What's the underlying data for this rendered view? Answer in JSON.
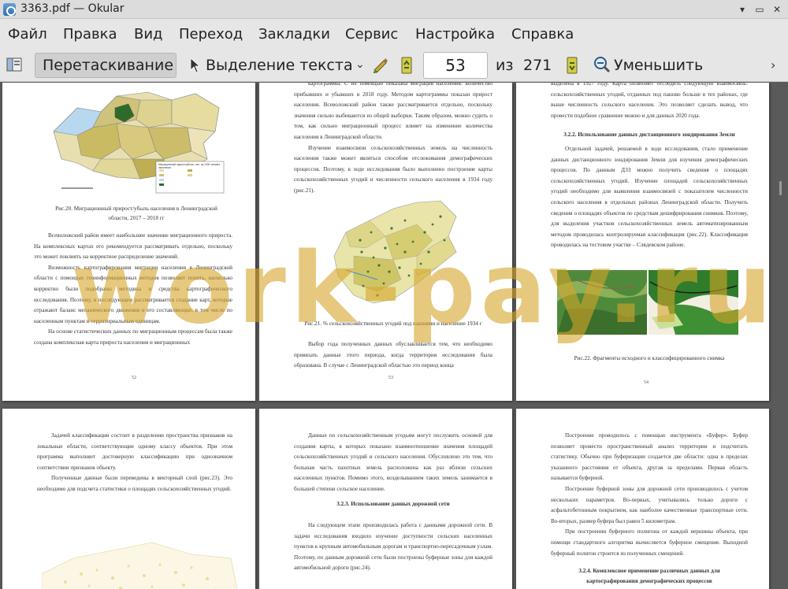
{
  "window": {
    "title": "3363.pdf  — Okular"
  },
  "menu": [
    "Файл",
    "Правка",
    "Вид",
    "Переход",
    "Закладки",
    "Сервис",
    "Настройка",
    "Справка"
  ],
  "toolbar": {
    "drag_label": "Перетаскивание",
    "select_label": "Выделение текста",
    "page_current": "53",
    "of_label": "из",
    "page_total": "271",
    "zoom_out_label": "Уменьшить"
  },
  "pages": {
    "p52": {
      "caption": "Рис.20. Миграционный прирост/убыль населения в Ленинградской области, 2017 – 2018 гг",
      "legend_title": "Миграционный прирост/убыль, чел. на 1000 человек населения",
      "paragraphs": [
        "Всеволожский район имеет наибольшее значение миграционного прироста. На комплексных картах его рекомендуется рассматривать отдельно, поскольку это может повлиять на корректное распределение значений.",
        "Возможность картографирования миграции населения в Ленинградской области с помощью геоинформационных методов позволяет понять, насколько корректно были подобраны методика и средства картографического исследования. Поэтому, в последующем рассматривается создание карт, которые отражают баланс механического движения и его составляющие, в том числе по населенным пунктам и территориальным единицам.",
        "На основе статистических данных по миграционным процессам была также создана комплексная карта прироста населения и миграционных"
      ],
      "number": "52"
    },
    "p53": {
      "paragraphs_top": [
        "картограммы. С их помощью показана миграция населения: количество прибывших и убывших в 2018 году. Методом картограммы показан прирост населения. Всеволожский район также рассматривается отдельно, поскольку значения сильно выбиваются из общей выборки. Таким образом, можно судить о том, как сильно миграционный процесс влияет на изменение количества населения в Ленинградской области.",
        "Изучение взаимосвязи сельскохозяйственных земель на численность населения также может являться способом отслеживания демографических процессов. Поэтому, в ходе исследования было выполнено построение карты сельскохозяйственных угодий и численности сельского населения в 1934 году (рис.21)."
      ],
      "caption": "Рис.21. % сельскохозяйственных угодий под пашнями и население 1934 г",
      "paragraphs_bottom": [
        "Выбор года полученных данных обуславливается тем, что необходимо привязать данные этого периода, когда территория исследования была образована. В случае с Ленинградской областью это период конца"
      ],
      "number": "53"
    },
    "p54": {
      "paragraph_top": "выделена в 1927 году. Карта позволяет отследить следующую взаимосвязь: сельскохозяйственных угодий, отданных под пашню больше в тех районах, где выше численность сельского населения. Это позволяет сделать вывод, что провести подобное сравнение можно и для данных 2020 года.",
      "heading": "3.2.2. Использование данных дистанционного зондирования Земли",
      "paragraphs": [
        "Отдельной задачей, решаемой в ходе исследования, стало применение данных дистанционного зондирования Земли для изучения демографических процессов. По данным ДЗЗ можно получить сведения о площадях сельскохозяйственных угодий. Изучение площадей сельскохозяйственных угодий необходимо для выявления взаимосвязей с показателем численности сельского населения в отдельных районах Ленинградской области. Получить сведения о площадях объектов по средствам дешифрирования снимков. Поэтому, для выделения участков сельскохозяйственных земель автоматизированным методом проводилась контролируемая классификация (рис.22). Классификация проводилась на тестовом участке – Слядевском районе."
      ],
      "caption": "Рис.22. Фрагменты исходного и классифицированного снимка",
      "number": "54"
    },
    "p55": {
      "paragraphs": [
        "Задачей классификации состоит в разделении пространства признаков на локальные области, соответствующие одному классу объектов. При этом программа выполняет достоверную классификацию при однозначном соответствии признаков объекту.",
        "Полученные данные были переведены в векторный слой (рис.23). Это необходимо для подсчета статистики о площадях сельскохозяйственных угодий."
      ]
    },
    "p56": {
      "paragraph_top": "Данные по сельскохозяйственным угодьям могут послужить основой для создания карты, в которых показано взаимоотношение значения площадей сельскохозяйственных угодий и сельского населения. Обусловлено это тем, что большая часть пахотных земель расположена как раз вблизи сельских населенных пунктов. Помимо этого, возделыванием таких земель занимается в большей степени сельское население.",
      "heading": "3.2.3. Использование данных дорожной сети",
      "paragraphs": [
        "На следующем этапе производилась работа с данными дорожной сети. В задачи исследования входило изучение доступности сельских населенных пунктов к крупным автомобильным дорогам и транспортно-пересадочным узлам. Поэтому, по данным дорожной сети были построены буферные зоны для каждой автомобильной дороги (рис.24)."
      ]
    },
    "p57": {
      "paragraphs": [
        "Построение проводилось с помощью инструмента «Буфер». Буфер позволяет провести пространственный анализ территории и подсчитать статистику. Обычно при буферизации создается две области: одна в пределах указанного расстояния от объекта, другая за пределами. Первая область называется буферной.",
        "Построение буферной зоны для дорожной сети производилось с учетом нескольких параметров. Во-первых, учитывались только дороги с асфальтобетонным покрытием, как наиболее качественные транспортные сети. Во-вторых, размер буфера был равен 5 километрам.",
        "При построении буферного полигона от каждой вершины объекта, при помощи стандартного алгоритма вычисляется буферное смещение. Выходной буферный полигон строится из полученных смещений."
      ],
      "heading": "3.2.4. Комплексное применение различных данных для картографирования демографических процессов"
    }
  },
  "watermark": "work-pay.ru",
  "colors": {
    "background": "#5a5a5a",
    "toolbar": "#e6e6e6",
    "watermark": "#d6a528"
  }
}
